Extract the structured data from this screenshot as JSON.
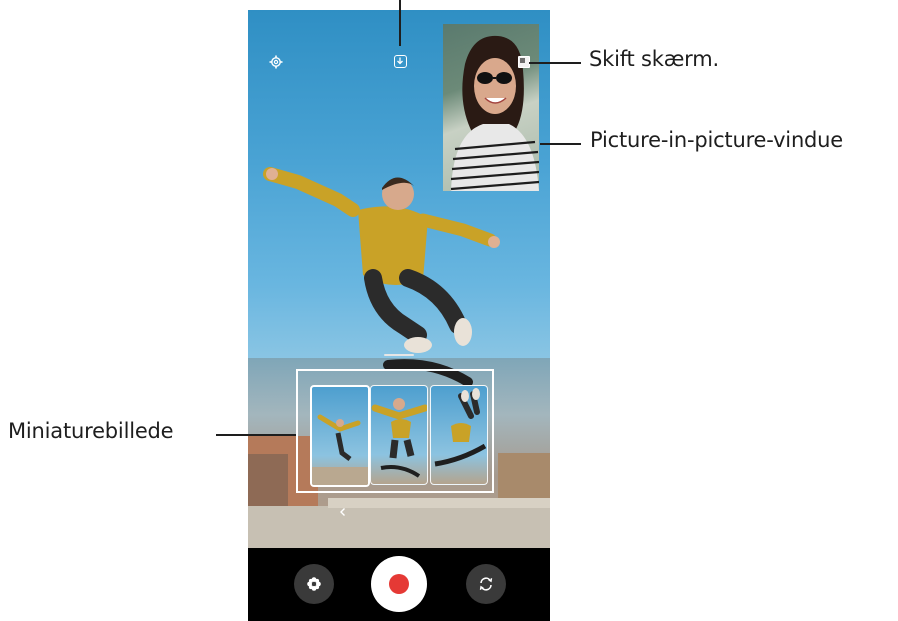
{
  "callouts": {
    "switch_screen": "Skift skærm.",
    "pip_window": "Picture-in-picture-vindue",
    "thumbnail": "Miniaturebillede"
  },
  "icons": {
    "settings": "gear-icon",
    "download": "download-icon",
    "switch_screen": "switch-screen-icon",
    "effects": "filter-flower-icon",
    "record": "record-icon",
    "switch_camera": "switch-camera-icon",
    "collapse": "chevron-left-icon"
  },
  "colors": {
    "record_dot": "#e53935",
    "bottom_bar": "#000000"
  }
}
